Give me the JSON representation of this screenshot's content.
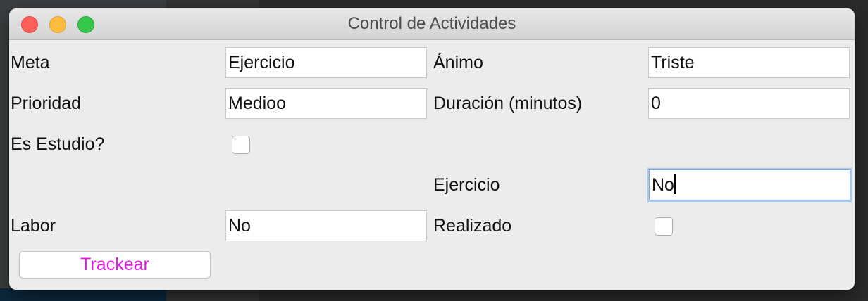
{
  "window": {
    "title": "Control de Actividades"
  },
  "form": {
    "meta_label": "Meta",
    "meta_value": "Ejercicio",
    "animo_label": "Ánimo",
    "animo_value": "Triste",
    "prioridad_label": "Prioridad",
    "prioridad_value": "Medioo",
    "duracion_label": "Duración (minutos)",
    "duracion_value": "0",
    "estudio_label": "Es Estudio?",
    "estudio_checked": false,
    "ejercicio_label": "Ejercicio",
    "ejercicio_value": "No",
    "labor_label": "Labor",
    "labor_value": "No",
    "realizado_label": "Realizado",
    "realizado_checked": false,
    "track_button_label": "Trackear"
  },
  "colors": {
    "button_text": "#e61ae6",
    "close": "#fc605b",
    "minimize": "#fdbc40",
    "maximize": "#34c84a"
  }
}
